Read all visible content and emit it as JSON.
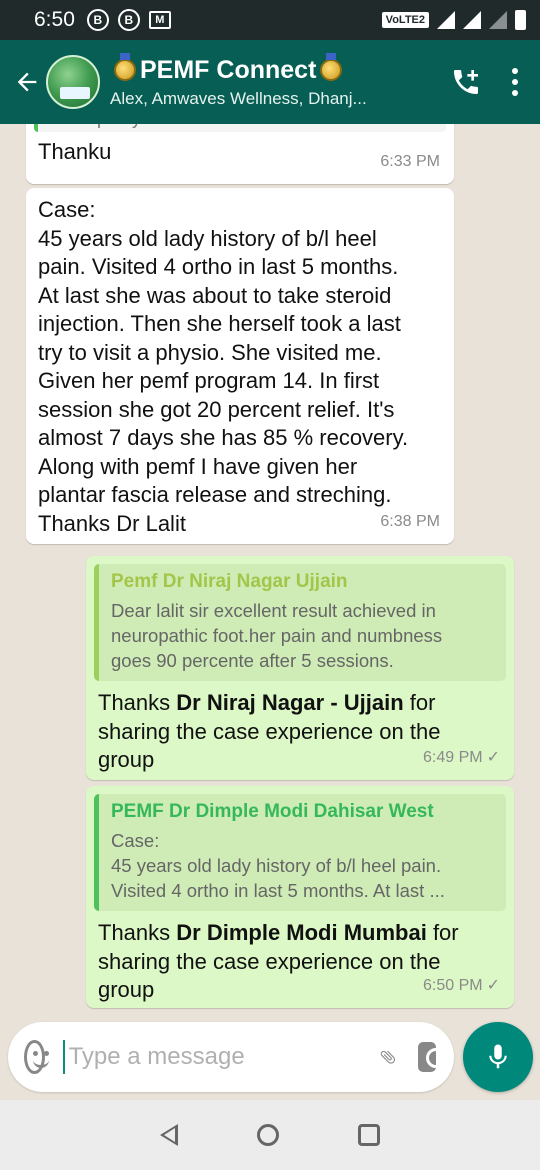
{
  "status_bar": {
    "time": "6:50",
    "badge1": "B",
    "badge2": "B",
    "mail": "M",
    "network": "VoLTE2"
  },
  "header": {
    "title": "PEMF Connect",
    "subtitle": "Alex, Amwaves Wellness, Dhanj..."
  },
  "messages": [
    {
      "id": "m1",
      "direction": "incoming",
      "text": "Thanku",
      "quoted_partial": "Neuropathy",
      "time": "6:33 PM"
    },
    {
      "id": "m2",
      "direction": "incoming",
      "lines": [
        "Case:",
        "45 years old lady history of b/l heel",
        "pain. Visited 4 ortho in last 5 months.",
        "At last she was about to take steroid",
        "injection. Then she herself took a last",
        "try to visit a physio. She visited me.",
        "Given her pemf program 14. In first",
        "session she got 20 percent relief. It's",
        "almost 7 days she has 85 % recovery.",
        "Along with pemf I have given her",
        "plantar fascia release and streching.",
        "Thanks Dr Lalit"
      ],
      "time": "6:38 PM"
    },
    {
      "id": "m3",
      "direction": "outgoing",
      "quote_author": "Pemf Dr Niraj Nagar Ujjain",
      "quote_lines": [
        "Dear lalit sir excellent result achieved in",
        "neuropathic foot.her pain and numbness",
        "goes 90 percente after 5 sessions."
      ],
      "text_before": "Thanks ",
      "text_bold": "Dr Niraj Nagar - Ujjain",
      "text_after": " for",
      "line2": "sharing the case experience on the",
      "line3": "group",
      "time": "6:49 PM",
      "tick": "✓"
    },
    {
      "id": "m4",
      "direction": "outgoing",
      "quote_author": "PEMF Dr Dimple Modi Dahisar West",
      "quote_lines": [
        "Case:",
        "45 years old lady history of b/l heel pain.",
        "Visited 4 ortho in last 5 months. At last ..."
      ],
      "text_before": "Thanks ",
      "text_bold": "Dr Dimple Modi Mumbai",
      "text_after": " for",
      "line2": "sharing the case experience on the",
      "line3": "group",
      "time": "6:50 PM",
      "tick": "✓"
    }
  ],
  "composer": {
    "placeholder": "Type a message"
  },
  "colors": {
    "header": "#075e54",
    "outgoing_bubble": "#dcf8c6",
    "incoming_bubble": "#ffffff",
    "mic_button": "#00897b"
  },
  "icons": {
    "back": "arrow-left-icon",
    "call": "add-call-icon",
    "menu": "more-vert-icon",
    "emoji": "emoji-icon",
    "attach": "paperclip-icon",
    "camera": "camera-icon",
    "mic": "mic-icon"
  }
}
